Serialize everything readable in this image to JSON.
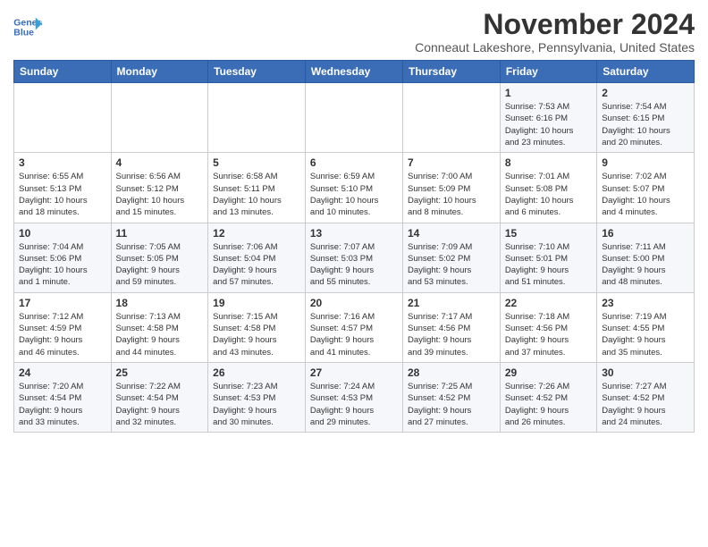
{
  "header": {
    "logo_line1": "General",
    "logo_line2": "Blue",
    "month": "November 2024",
    "location": "Conneaut Lakeshore, Pennsylvania, United States"
  },
  "weekdays": [
    "Sunday",
    "Monday",
    "Tuesday",
    "Wednesday",
    "Thursday",
    "Friday",
    "Saturday"
  ],
  "weeks": [
    [
      {
        "day": "",
        "info": ""
      },
      {
        "day": "",
        "info": ""
      },
      {
        "day": "",
        "info": ""
      },
      {
        "day": "",
        "info": ""
      },
      {
        "day": "",
        "info": ""
      },
      {
        "day": "1",
        "info": "Sunrise: 7:53 AM\nSunset: 6:16 PM\nDaylight: 10 hours\nand 23 minutes."
      },
      {
        "day": "2",
        "info": "Sunrise: 7:54 AM\nSunset: 6:15 PM\nDaylight: 10 hours\nand 20 minutes."
      }
    ],
    [
      {
        "day": "3",
        "info": "Sunrise: 6:55 AM\nSunset: 5:13 PM\nDaylight: 10 hours\nand 18 minutes."
      },
      {
        "day": "4",
        "info": "Sunrise: 6:56 AM\nSunset: 5:12 PM\nDaylight: 10 hours\nand 15 minutes."
      },
      {
        "day": "5",
        "info": "Sunrise: 6:58 AM\nSunset: 5:11 PM\nDaylight: 10 hours\nand 13 minutes."
      },
      {
        "day": "6",
        "info": "Sunrise: 6:59 AM\nSunset: 5:10 PM\nDaylight: 10 hours\nand 10 minutes."
      },
      {
        "day": "7",
        "info": "Sunrise: 7:00 AM\nSunset: 5:09 PM\nDaylight: 10 hours\nand 8 minutes."
      },
      {
        "day": "8",
        "info": "Sunrise: 7:01 AM\nSunset: 5:08 PM\nDaylight: 10 hours\nand 6 minutes."
      },
      {
        "day": "9",
        "info": "Sunrise: 7:02 AM\nSunset: 5:07 PM\nDaylight: 10 hours\nand 4 minutes."
      }
    ],
    [
      {
        "day": "10",
        "info": "Sunrise: 7:04 AM\nSunset: 5:06 PM\nDaylight: 10 hours\nand 1 minute."
      },
      {
        "day": "11",
        "info": "Sunrise: 7:05 AM\nSunset: 5:05 PM\nDaylight: 9 hours\nand 59 minutes."
      },
      {
        "day": "12",
        "info": "Sunrise: 7:06 AM\nSunset: 5:04 PM\nDaylight: 9 hours\nand 57 minutes."
      },
      {
        "day": "13",
        "info": "Sunrise: 7:07 AM\nSunset: 5:03 PM\nDaylight: 9 hours\nand 55 minutes."
      },
      {
        "day": "14",
        "info": "Sunrise: 7:09 AM\nSunset: 5:02 PM\nDaylight: 9 hours\nand 53 minutes."
      },
      {
        "day": "15",
        "info": "Sunrise: 7:10 AM\nSunset: 5:01 PM\nDaylight: 9 hours\nand 51 minutes."
      },
      {
        "day": "16",
        "info": "Sunrise: 7:11 AM\nSunset: 5:00 PM\nDaylight: 9 hours\nand 48 minutes."
      }
    ],
    [
      {
        "day": "17",
        "info": "Sunrise: 7:12 AM\nSunset: 4:59 PM\nDaylight: 9 hours\nand 46 minutes."
      },
      {
        "day": "18",
        "info": "Sunrise: 7:13 AM\nSunset: 4:58 PM\nDaylight: 9 hours\nand 44 minutes."
      },
      {
        "day": "19",
        "info": "Sunrise: 7:15 AM\nSunset: 4:58 PM\nDaylight: 9 hours\nand 43 minutes."
      },
      {
        "day": "20",
        "info": "Sunrise: 7:16 AM\nSunset: 4:57 PM\nDaylight: 9 hours\nand 41 minutes."
      },
      {
        "day": "21",
        "info": "Sunrise: 7:17 AM\nSunset: 4:56 PM\nDaylight: 9 hours\nand 39 minutes."
      },
      {
        "day": "22",
        "info": "Sunrise: 7:18 AM\nSunset: 4:56 PM\nDaylight: 9 hours\nand 37 minutes."
      },
      {
        "day": "23",
        "info": "Sunrise: 7:19 AM\nSunset: 4:55 PM\nDaylight: 9 hours\nand 35 minutes."
      }
    ],
    [
      {
        "day": "24",
        "info": "Sunrise: 7:20 AM\nSunset: 4:54 PM\nDaylight: 9 hours\nand 33 minutes."
      },
      {
        "day": "25",
        "info": "Sunrise: 7:22 AM\nSunset: 4:54 PM\nDaylight: 9 hours\nand 32 minutes."
      },
      {
        "day": "26",
        "info": "Sunrise: 7:23 AM\nSunset: 4:53 PM\nDaylight: 9 hours\nand 30 minutes."
      },
      {
        "day": "27",
        "info": "Sunrise: 7:24 AM\nSunset: 4:53 PM\nDaylight: 9 hours\nand 29 minutes."
      },
      {
        "day": "28",
        "info": "Sunrise: 7:25 AM\nSunset: 4:52 PM\nDaylight: 9 hours\nand 27 minutes."
      },
      {
        "day": "29",
        "info": "Sunrise: 7:26 AM\nSunset: 4:52 PM\nDaylight: 9 hours\nand 26 minutes."
      },
      {
        "day": "30",
        "info": "Sunrise: 7:27 AM\nSunset: 4:52 PM\nDaylight: 9 hours\nand 24 minutes."
      }
    ]
  ]
}
